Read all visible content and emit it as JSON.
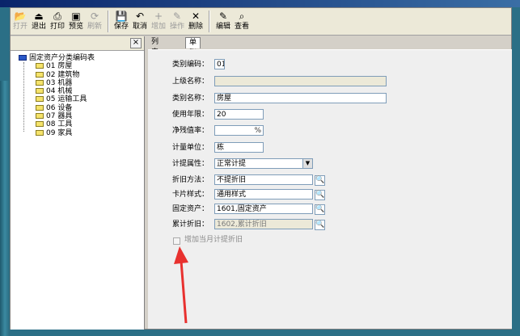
{
  "toolbar": {
    "buttons": [
      {
        "label": "打开",
        "icon": "open-folder-icon",
        "glyph": "📂",
        "enabled": false
      },
      {
        "label": "退出",
        "icon": "exit-icon",
        "glyph": "⏏",
        "enabled": true
      },
      {
        "label": "打印",
        "icon": "printer-icon",
        "glyph": "⎙",
        "enabled": true
      },
      {
        "label": "预览",
        "icon": "preview-icon",
        "glyph": "▣",
        "enabled": true
      },
      {
        "label": "刷新",
        "icon": "refresh-icon",
        "glyph": "⟳",
        "enabled": false
      },
      {
        "label": "保存",
        "icon": "save-icon",
        "glyph": "💾",
        "enabled": true
      },
      {
        "label": "取消",
        "icon": "cancel-icon",
        "glyph": "↶",
        "enabled": true
      },
      {
        "label": "增加",
        "icon": "add-icon",
        "glyph": "+",
        "enabled": false
      },
      {
        "label": "操作",
        "icon": "operate-icon",
        "glyph": "✎",
        "enabled": false
      },
      {
        "label": "删除",
        "icon": "delete-icon",
        "glyph": "✕",
        "enabled": true
      },
      {
        "label": "编辑",
        "icon": "edit-icon",
        "glyph": "✎",
        "enabled": true
      },
      {
        "label": "查看",
        "icon": "view-icon",
        "glyph": "⌕",
        "enabled": true
      }
    ]
  },
  "tree": {
    "close_glyph": "×",
    "root": "固定资产分类编码表",
    "items": [
      "01 房屋",
      "02 建筑物",
      "03 机器",
      "04 机械",
      "05 运输工具",
      "06 设备",
      "07 器具",
      "08 工具",
      "09 家具"
    ]
  },
  "tabs": [
    "列表视图",
    "单张视图"
  ],
  "form": {
    "code_label": "类别编码：",
    "code_value": "01",
    "parent_label": "上级名称：",
    "parent_value": "",
    "name_label": "类别名称：",
    "name_value": "房屋",
    "life_label": "使用年限：",
    "life_value": "20",
    "residual_label": "净残值率：",
    "residual_value": "",
    "residual_unit": "%",
    "unit_label": "计量单位：",
    "unit_value": "栋",
    "attr_label": "计提属性：",
    "attr_value": "正常计提",
    "attr_arrow": "▼",
    "method_label": "折旧方法：",
    "method_value": "不提折旧",
    "card_label": "卡片样式：",
    "card_value": "通用样式",
    "asset_label": "固定资产：",
    "asset_value": "1601,固定资产",
    "depr_label": "累计折旧：",
    "depr_value": "1602,累计折旧",
    "search_glyph": "🔍",
    "checkbox_label": "增加当月计提折旧",
    "checkbox_checked": false
  }
}
